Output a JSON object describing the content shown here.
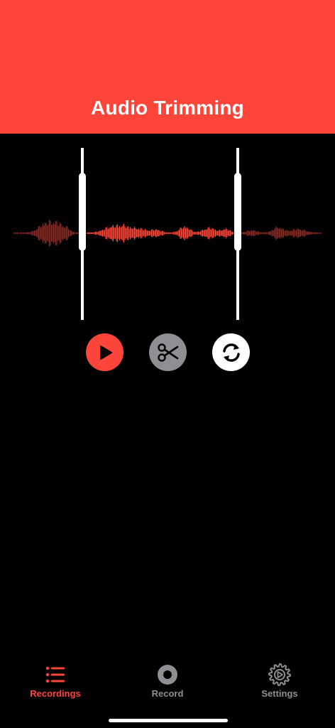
{
  "header": {
    "title": "Audio Trimming"
  },
  "editor": {
    "trim_start_fraction": 0.21,
    "trim_end_fraction": 0.73
  },
  "controls": {
    "play": {
      "icon": "play-icon",
      "color": "#FF453A"
    },
    "trim": {
      "icon": "scissors-icon",
      "color": "#8E8E93"
    },
    "reset": {
      "icon": "refresh-icon",
      "color": "#FFFFFF"
    }
  },
  "tabbar": {
    "tabs": [
      {
        "label": "Recordings",
        "icon": "list-icon",
        "active": true
      },
      {
        "label": "Record",
        "icon": "record-icon",
        "active": false
      },
      {
        "label": "Settings",
        "icon": "gear-icon",
        "active": false
      }
    ]
  },
  "colors": {
    "accent": "#FF453A",
    "accent_dim": "#8A2A24",
    "inactive": "#8E8E93",
    "background": "#000000"
  }
}
